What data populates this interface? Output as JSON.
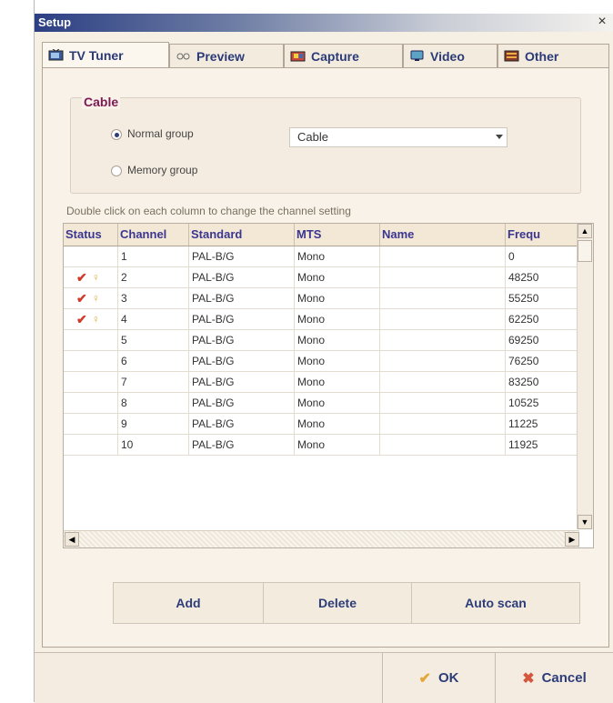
{
  "window": {
    "title": "Setup",
    "close_glyph": "×"
  },
  "tabs": [
    {
      "label": "TV Tuner",
      "icon": "tv-tuner-icon",
      "active": true
    },
    {
      "label": "Preview",
      "icon": "preview-icon"
    },
    {
      "label": "Capture",
      "icon": "capture-icon"
    },
    {
      "label": "Video",
      "icon": "video-icon"
    },
    {
      "label": "Other",
      "icon": "other-icon"
    }
  ],
  "cable_group": {
    "title": "Cable",
    "normal_group_label": "Normal group",
    "memory_group_label": "Memory group",
    "selected": "normal",
    "select_value": "Cable"
  },
  "hint": "Double click on each column to change the channel setting",
  "table": {
    "columns": [
      "Status",
      "Channel",
      "Standard",
      "MTS",
      "Name",
      "Frequ"
    ],
    "rows": [
      {
        "status": false,
        "channel": "1",
        "standard": "PAL-B/G",
        "mts": "Mono",
        "name": "",
        "freq": "0"
      },
      {
        "status": true,
        "channel": "2",
        "standard": "PAL-B/G",
        "mts": "Mono",
        "name": "",
        "freq": "48250"
      },
      {
        "status": true,
        "channel": "3",
        "standard": "PAL-B/G",
        "mts": "Mono",
        "name": "",
        "freq": "55250"
      },
      {
        "status": true,
        "channel": "4",
        "standard": "PAL-B/G",
        "mts": "Mono",
        "name": "",
        "freq": "62250"
      },
      {
        "status": false,
        "channel": "5",
        "standard": "PAL-B/G",
        "mts": "Mono",
        "name": "",
        "freq": "69250"
      },
      {
        "status": false,
        "channel": "6",
        "standard": "PAL-B/G",
        "mts": "Mono",
        "name": "",
        "freq": "76250"
      },
      {
        "status": false,
        "channel": "7",
        "standard": "PAL-B/G",
        "mts": "Mono",
        "name": "",
        "freq": "83250"
      },
      {
        "status": false,
        "channel": "8",
        "standard": "PAL-B/G",
        "mts": "Mono",
        "name": "",
        "freq": "10525"
      },
      {
        "status": false,
        "channel": "9",
        "standard": "PAL-B/G",
        "mts": "Mono",
        "name": "",
        "freq": "11225"
      },
      {
        "status": false,
        "channel": "10",
        "standard": "PAL-B/G",
        "mts": "Mono",
        "name": "",
        "freq": "11925"
      }
    ]
  },
  "actions": {
    "add": "Add",
    "delete": "Delete",
    "auto_scan": "Auto scan"
  },
  "footer": {
    "ok": "OK",
    "cancel": "Cancel"
  },
  "colors": {
    "title_gradient_start": "#2c3f83",
    "tab_text": "#2b3b78",
    "group_title": "#7b1a54",
    "column_header_text": "#3b3690",
    "check_mark": "#d03a2a"
  }
}
